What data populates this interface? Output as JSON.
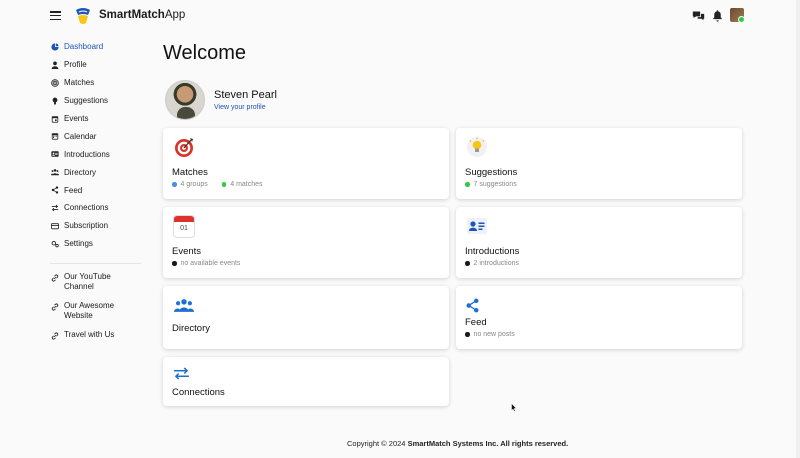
{
  "header": {
    "brand_bold": "SmartMatch",
    "brand_rest": "App"
  },
  "sidebar": {
    "items": [
      {
        "label": "Dashboard",
        "icon": "dashboard-icon"
      },
      {
        "label": "Profile",
        "icon": "person-icon"
      },
      {
        "label": "Matches",
        "icon": "target-icon"
      },
      {
        "label": "Suggestions",
        "icon": "lightbulb-icon"
      },
      {
        "label": "Events",
        "icon": "calendar-event-icon"
      },
      {
        "label": "Calendar",
        "icon": "calendar-icon"
      },
      {
        "label": "Introductions",
        "icon": "contact-card-icon"
      },
      {
        "label": "Directory",
        "icon": "people-icon"
      },
      {
        "label": "Feed",
        "icon": "share-icon"
      },
      {
        "label": "Connections",
        "icon": "arrows-icon"
      },
      {
        "label": "Subscription",
        "icon": "card-icon"
      },
      {
        "label": "Settings",
        "icon": "gear-icon"
      }
    ],
    "external": [
      {
        "line1": "Our YouTube",
        "line2": "Channel"
      },
      {
        "line1": "Our Awesome",
        "line2": "Website"
      },
      {
        "line1": "Travel with Us",
        "line2": ""
      }
    ]
  },
  "main": {
    "welcome": "Welcome",
    "profile_name": "Steven Pearl",
    "profile_link": "View your profile",
    "cards": {
      "matches": {
        "title": "Matches",
        "meta1": "4 groups",
        "meta2": "4 matches"
      },
      "suggestions": {
        "title": "Suggestions",
        "meta1": "7 suggestions"
      },
      "events": {
        "title": "Events",
        "meta1": "no available events",
        "cal_day": "01"
      },
      "introductions": {
        "title": "Introductions",
        "meta1": "2 introductions"
      },
      "directory": {
        "title": "Directory"
      },
      "feed": {
        "title": "Feed",
        "meta1": "no new posts"
      },
      "connections": {
        "title": "Connections"
      }
    }
  },
  "footer": {
    "prefix": "Copyright © 2024 ",
    "company": "SmartMatch Systems Inc. All rights reserved."
  },
  "colors": {
    "accent": "#1f54b8",
    "dot_blue": "#4a90e2",
    "dot_green": "#2ecc40",
    "dot_dark": "#1a1a1a"
  }
}
